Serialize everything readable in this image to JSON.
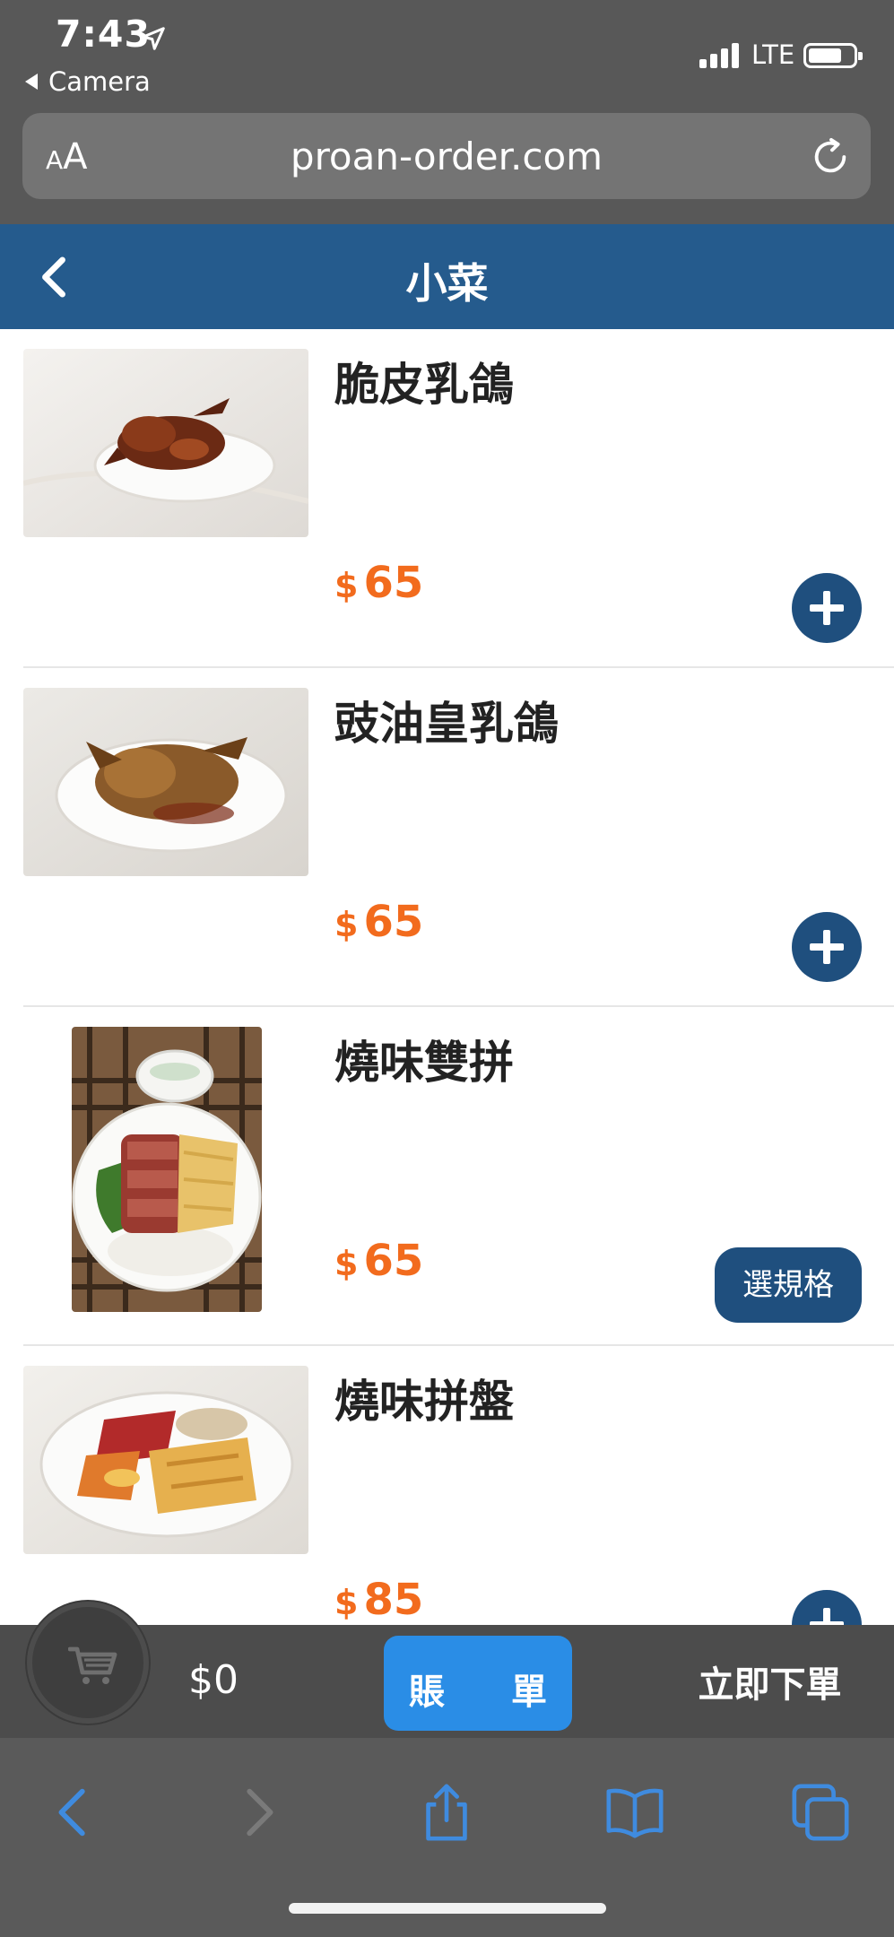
{
  "status_bar": {
    "time": "7:43",
    "back_app": "Camera",
    "network": "LTE"
  },
  "browser": {
    "text_size_label": "AA",
    "url": "proan-order.com"
  },
  "header": {
    "title": "小菜"
  },
  "items": [
    {
      "name": "脆皮乳鴿",
      "currency": "$",
      "price": "65",
      "action": "add"
    },
    {
      "name": "豉油皇乳鴿",
      "currency": "$",
      "price": "65",
      "action": "add"
    },
    {
      "name": "燒味雙拼",
      "currency": "$",
      "price": "65",
      "action": "spec",
      "action_label": "選規格"
    },
    {
      "name": "燒味拼盤",
      "currency": "$",
      "price": "85",
      "action": "add"
    }
  ],
  "cart": {
    "total": "$0",
    "bill_left": "賬",
    "bill_right": "單",
    "order_label": "立即下單"
  },
  "colors": {
    "header_bg": "#255b8d",
    "price": "#f26b1d",
    "button_dark": "#1f4f7e",
    "bill_button": "#2a8de6",
    "toolbar_icon": "#3f8bdf"
  },
  "icons": [
    "location-arrow-icon",
    "reload-icon",
    "back-chevron-icon",
    "plus-icon",
    "cart-icon",
    "back-icon",
    "forward-icon",
    "share-icon",
    "bookmarks-icon",
    "tabs-icon"
  ]
}
